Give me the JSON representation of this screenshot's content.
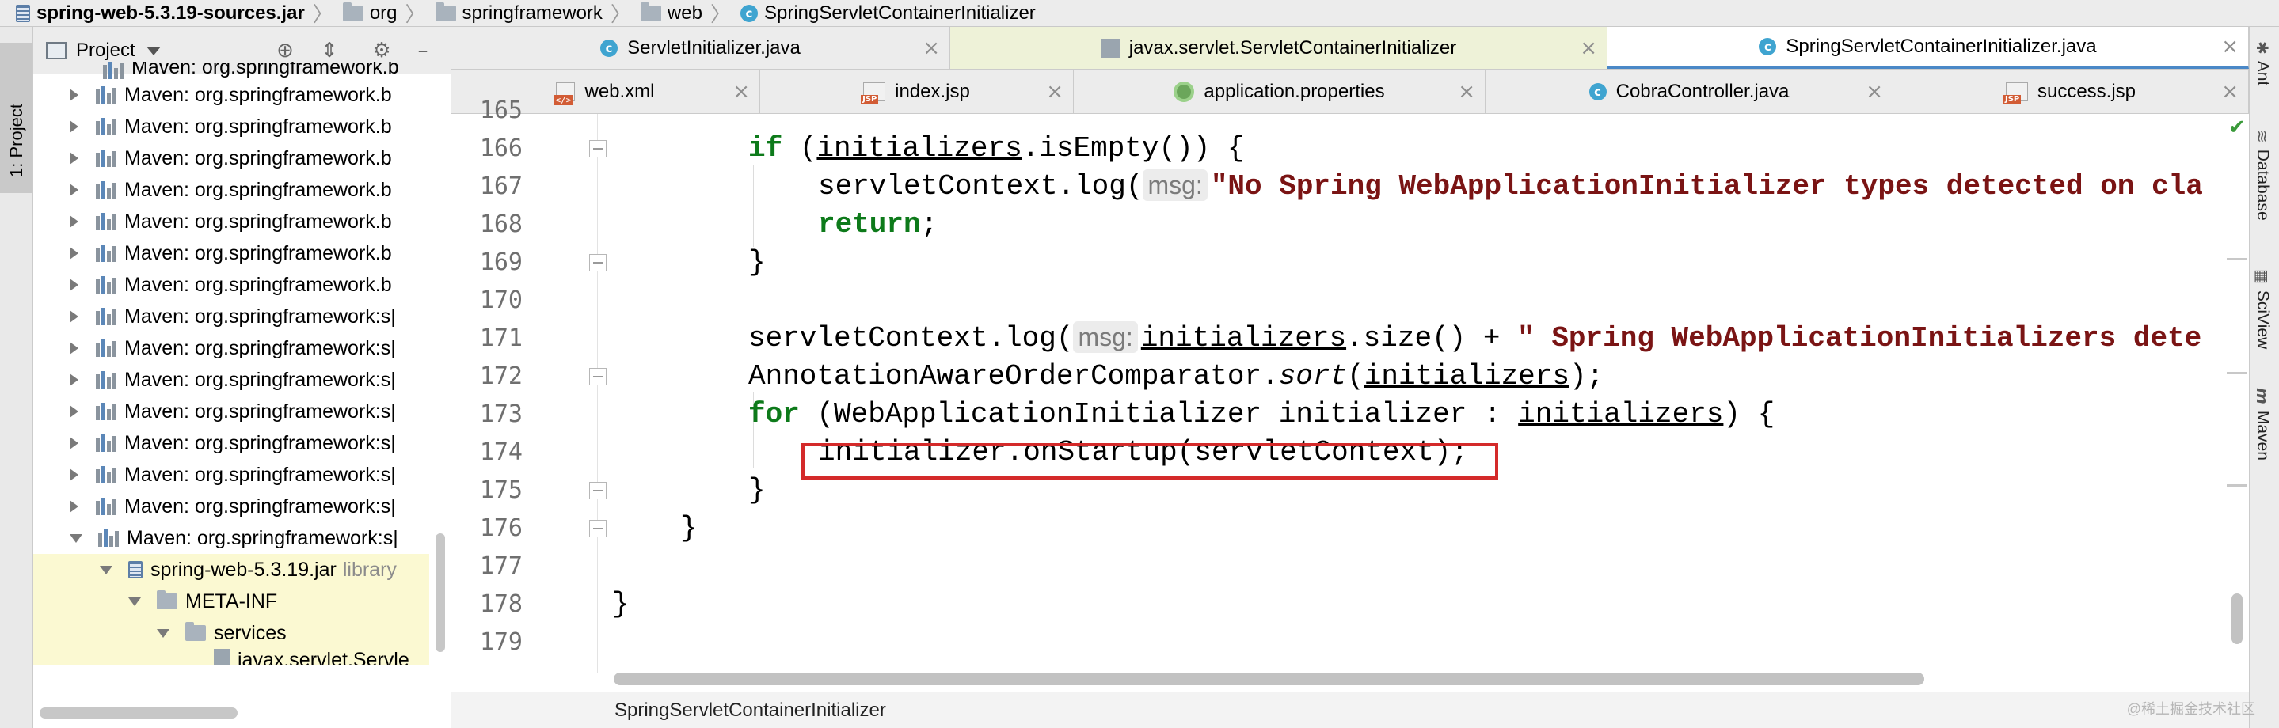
{
  "breadcrumb": [
    {
      "label": "spring-web-5.3.19-sources.jar",
      "icon": "jar-icon"
    },
    {
      "label": "org",
      "icon": "folder-icon"
    },
    {
      "label": "springframework",
      "icon": "folder-icon"
    },
    {
      "label": "web",
      "icon": "folder-icon"
    },
    {
      "label": "SpringServletContainerInitializer",
      "icon": "class-icon"
    }
  ],
  "left_stripe": {
    "label": "1: Project"
  },
  "project": {
    "title": "Project",
    "tree": [
      {
        "label": "Maven: org.springframework.b",
        "kind": "library",
        "expand": "collapsed"
      },
      {
        "label": "Maven: org.springframework.b",
        "kind": "library",
        "expand": "collapsed"
      },
      {
        "label": "Maven: org.springframework.b",
        "kind": "library",
        "expand": "collapsed"
      },
      {
        "label": "Maven: org.springframework.b",
        "kind": "library",
        "expand": "collapsed"
      },
      {
        "label": "Maven: org.springframework.b",
        "kind": "library",
        "expand": "collapsed"
      },
      {
        "label": "Maven: org.springframework.b",
        "kind": "library",
        "expand": "collapsed"
      },
      {
        "label": "Maven: org.springframework.b",
        "kind": "library",
        "expand": "collapsed"
      },
      {
        "label": "Maven: org.springframework.b",
        "kind": "library",
        "expand": "collapsed"
      },
      {
        "label": "Maven: org.springframework:s|",
        "kind": "library",
        "expand": "collapsed"
      },
      {
        "label": "Maven: org.springframework:s|",
        "kind": "library",
        "expand": "collapsed"
      },
      {
        "label": "Maven: org.springframework:s|",
        "kind": "library",
        "expand": "collapsed"
      },
      {
        "label": "Maven: org.springframework:s|",
        "kind": "library",
        "expand": "collapsed"
      },
      {
        "label": "Maven: org.springframework:s|",
        "kind": "library",
        "expand": "collapsed"
      },
      {
        "label": "Maven: org.springframework:s|",
        "kind": "library",
        "expand": "collapsed"
      },
      {
        "label": "Maven: org.springframework:s|",
        "kind": "library",
        "expand": "collapsed"
      },
      {
        "label": "Maven: org.springframework:s|",
        "kind": "library",
        "expand": "expanded"
      },
      {
        "label": "spring-web-5.3.19.jar",
        "suffix": "library",
        "kind": "jar",
        "expand": "expanded"
      },
      {
        "label": "META-INF",
        "kind": "folder",
        "expand": "expanded"
      },
      {
        "label": "services",
        "kind": "folder",
        "expand": "expanded"
      },
      {
        "label": "javax.servlet.Servle",
        "kind": "file",
        "expand": "none"
      }
    ]
  },
  "tabs_row1": [
    {
      "label": "ServletInitializer.java",
      "icon": "class-icon"
    },
    {
      "label": "javax.servlet.ServletContainerInitializer",
      "icon": "interface-file-icon"
    },
    {
      "label": "SpringServletContainerInitializer.java",
      "icon": "class-icon",
      "active": true
    }
  ],
  "tabs_row2": [
    {
      "label": "web.xml",
      "icon": "xml-icon"
    },
    {
      "label": "index.jsp",
      "icon": "jsp-icon"
    },
    {
      "label": "application.properties",
      "icon": "properties-icon"
    },
    {
      "label": "CobraController.java",
      "icon": "class-icon"
    },
    {
      "label": "success.jsp",
      "icon": "jsp-icon"
    }
  ],
  "editor": {
    "first_line_partial": "165",
    "line_numbers": [
      "166",
      "167",
      "168",
      "169",
      "170",
      "171",
      "172",
      "173",
      "174",
      "175",
      "176",
      "177",
      "178",
      "179"
    ],
    "code": {
      "l166_kw": "if",
      "l166_a": " (",
      "l166_var": "initializers",
      "l166_b": ".isEmpty()) {",
      "l167_a": "servletContext.log(",
      "l167_hint": "msg:",
      "l167_str": "\"No Spring WebApplicationInitializer types detected on cla",
      "l168_kw": "return",
      "l168_b": ";",
      "l169": "}",
      "l171_a": "servletContext.log(",
      "l171_hint": "msg:",
      "l171_var": "initializers",
      "l171_b": ".size() + ",
      "l171_str": "\" Spring WebApplicationInitializers dete",
      "l172_a": "AnnotationAwareOrderComparator.",
      "l172_it": "sort",
      "l172_b": "(",
      "l172_var": "initializers",
      "l172_c": ");",
      "l173_kw": "for",
      "l173_a": " (WebApplicationInitializer initializer : ",
      "l173_var": "initializers",
      "l173_b": ") {",
      "l174": "initializer.onStartup(servletContext);",
      "l175": "}",
      "l176": "}",
      "l178": "}"
    }
  },
  "status_crumb": "SpringServletContainerInitializer",
  "right_stripe": [
    {
      "label": "Ant",
      "icon": "ant-icon"
    },
    {
      "label": "Database",
      "icon": "database-icon"
    },
    {
      "label": "SciView",
      "icon": "sciview-icon"
    },
    {
      "label": "Maven",
      "icon": "maven-icon"
    }
  ],
  "watermark": "@稀土掘金技术社区",
  "colors": {
    "keyword": "#0d7a1a",
    "string": "#7a1414",
    "highlight_box": "#d42a2a",
    "active_tab_underline": "#4a88c7"
  }
}
